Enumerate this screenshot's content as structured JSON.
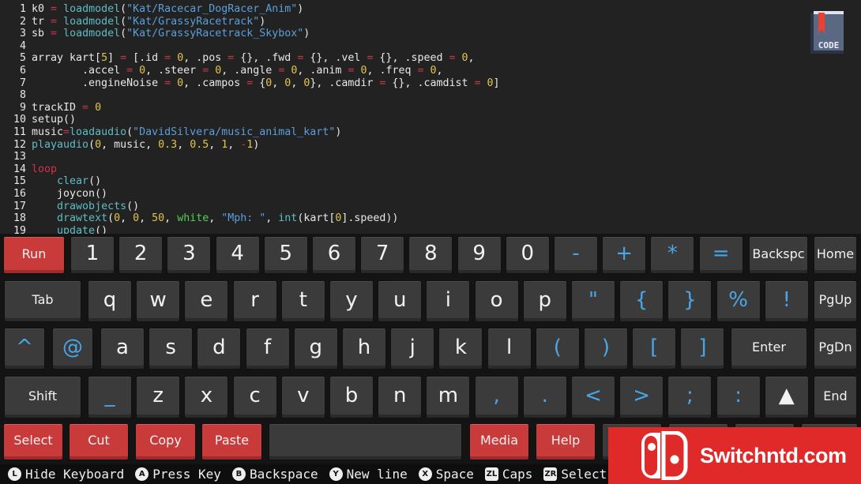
{
  "code": {
    "lines": [
      {
        "n": "1",
        "tokens": [
          [
            "plain",
            "k0 "
          ],
          [
            "op",
            "="
          ],
          [
            "plain",
            " "
          ],
          [
            "fn",
            "loadmodel"
          ],
          [
            "plain",
            "("
          ],
          [
            "str",
            "\"Kat/Racecar_DogRacer_Anim\""
          ],
          [
            "plain",
            ")"
          ]
        ]
      },
      {
        "n": "2",
        "tokens": [
          [
            "plain",
            "tr "
          ],
          [
            "op",
            "="
          ],
          [
            "plain",
            " "
          ],
          [
            "fn",
            "loadmodel"
          ],
          [
            "plain",
            "("
          ],
          [
            "str",
            "\"Kat/GrassyRacetrack\""
          ],
          [
            "plain",
            ")"
          ]
        ]
      },
      {
        "n": "3",
        "tokens": [
          [
            "plain",
            "sb "
          ],
          [
            "op",
            "="
          ],
          [
            "plain",
            " "
          ],
          [
            "fn",
            "loadmodel"
          ],
          [
            "plain",
            "("
          ],
          [
            "str",
            "\"Kat/GrassyRacetrack_Skybox\""
          ],
          [
            "plain",
            ")"
          ]
        ]
      },
      {
        "n": "4",
        "tokens": []
      },
      {
        "n": "5",
        "tokens": [
          [
            "plain",
            "array kart["
          ],
          [
            "num",
            "5"
          ],
          [
            "plain",
            "] "
          ],
          [
            "op",
            "="
          ],
          [
            "plain",
            " [.id "
          ],
          [
            "op",
            "="
          ],
          [
            "plain",
            " "
          ],
          [
            "num",
            "0"
          ],
          [
            "plain",
            ", .pos "
          ],
          [
            "op",
            "="
          ],
          [
            "plain",
            " {}, .fwd "
          ],
          [
            "op",
            "="
          ],
          [
            "plain",
            " {}, .vel "
          ],
          [
            "op",
            "="
          ],
          [
            "plain",
            " {}, .speed "
          ],
          [
            "op",
            "="
          ],
          [
            "plain",
            " "
          ],
          [
            "num",
            "0"
          ],
          [
            "plain",
            ","
          ]
        ]
      },
      {
        "n": "6",
        "tokens": [
          [
            "plain",
            "        .accel "
          ],
          [
            "op",
            "="
          ],
          [
            "plain",
            " "
          ],
          [
            "num",
            "0"
          ],
          [
            "plain",
            ", .steer "
          ],
          [
            "op",
            "="
          ],
          [
            "plain",
            " "
          ],
          [
            "num",
            "0"
          ],
          [
            "plain",
            ", .angle "
          ],
          [
            "op",
            "="
          ],
          [
            "plain",
            " "
          ],
          [
            "num",
            "0"
          ],
          [
            "plain",
            ", .anim "
          ],
          [
            "op",
            "="
          ],
          [
            "plain",
            " "
          ],
          [
            "num",
            "0"
          ],
          [
            "plain",
            ", .freq "
          ],
          [
            "op",
            "="
          ],
          [
            "plain",
            " "
          ],
          [
            "num",
            "0"
          ],
          [
            "plain",
            ","
          ]
        ]
      },
      {
        "n": "7",
        "tokens": [
          [
            "plain",
            "        .engineNoise "
          ],
          [
            "op",
            "="
          ],
          [
            "plain",
            " "
          ],
          [
            "num",
            "0"
          ],
          [
            "plain",
            ", .campos "
          ],
          [
            "op",
            "="
          ],
          [
            "plain",
            " {"
          ],
          [
            "num",
            "0"
          ],
          [
            "plain",
            ", "
          ],
          [
            "num",
            "0"
          ],
          [
            "plain",
            ", "
          ],
          [
            "num",
            "0"
          ],
          [
            "plain",
            "}, .camdir "
          ],
          [
            "op",
            "="
          ],
          [
            "plain",
            " {}, .camdist "
          ],
          [
            "op",
            "="
          ],
          [
            "plain",
            " "
          ],
          [
            "num",
            "0"
          ],
          [
            "plain",
            "]"
          ]
        ]
      },
      {
        "n": "8",
        "tokens": []
      },
      {
        "n": "9",
        "tokens": [
          [
            "plain",
            "trackID "
          ],
          [
            "op",
            "="
          ],
          [
            "plain",
            " "
          ],
          [
            "num",
            "0"
          ]
        ]
      },
      {
        "n": "10",
        "tokens": [
          [
            "plain",
            "setup()"
          ]
        ]
      },
      {
        "n": "11",
        "tokens": [
          [
            "plain",
            "music"
          ],
          [
            "op",
            "="
          ],
          [
            "fn",
            "loadaudio"
          ],
          [
            "plain",
            "("
          ],
          [
            "str",
            "\"DavidSilvera/music_animal_kart\""
          ],
          [
            "plain",
            ")"
          ]
        ]
      },
      {
        "n": "12",
        "tokens": [
          [
            "fn",
            "playaudio"
          ],
          [
            "plain",
            "("
          ],
          [
            "num",
            "0"
          ],
          [
            "plain",
            ", music, "
          ],
          [
            "num",
            "0.3"
          ],
          [
            "plain",
            ", "
          ],
          [
            "num",
            "0.5"
          ],
          [
            "plain",
            ", "
          ],
          [
            "num",
            "1"
          ],
          [
            "plain",
            ", "
          ],
          [
            "op",
            "-"
          ],
          [
            "num",
            "1"
          ],
          [
            "plain",
            ")"
          ]
        ]
      },
      {
        "n": "13",
        "tokens": []
      },
      {
        "n": "14",
        "tokens": [
          [
            "kw",
            "loop"
          ]
        ]
      },
      {
        "n": "15",
        "tokens": [
          [
            "plain",
            "    "
          ],
          [
            "fn",
            "clear"
          ],
          [
            "plain",
            "()"
          ]
        ]
      },
      {
        "n": "16",
        "tokens": [
          [
            "plain",
            "    joycon()"
          ]
        ]
      },
      {
        "n": "17",
        "tokens": [
          [
            "plain",
            "    "
          ],
          [
            "fn",
            "drawobjects"
          ],
          [
            "plain",
            "()"
          ]
        ]
      },
      {
        "n": "18",
        "tokens": [
          [
            "plain",
            "    "
          ],
          [
            "fn",
            "drawtext"
          ],
          [
            "plain",
            "("
          ],
          [
            "num",
            "0"
          ],
          [
            "plain",
            ", "
          ],
          [
            "num",
            "0"
          ],
          [
            "plain",
            ", "
          ],
          [
            "num",
            "50"
          ],
          [
            "plain",
            ", "
          ],
          [
            "grn",
            "white"
          ],
          [
            "plain",
            ", "
          ],
          [
            "str",
            "\"Mph: \""
          ],
          [
            "plain",
            ", "
          ],
          [
            "fn",
            "int"
          ],
          [
            "plain",
            "(kart["
          ],
          [
            "num",
            "0"
          ],
          [
            "plain",
            "].speed))"
          ]
        ]
      },
      {
        "n": "19",
        "tokens": [
          [
            "plain",
            "    "
          ],
          [
            "fn",
            "update"
          ],
          [
            "plain",
            "()"
          ]
        ]
      }
    ]
  },
  "code_icon": {
    "label": "CODE",
    "icon": "code-book-icon"
  },
  "keyboard": {
    "rows": [
      [
        {
          "l": "Run",
          "s": "red"
        },
        {
          "l": "1"
        },
        {
          "l": "2"
        },
        {
          "l": "3"
        },
        {
          "l": "4"
        },
        {
          "l": "5"
        },
        {
          "l": "6"
        },
        {
          "l": "7"
        },
        {
          "l": "8"
        },
        {
          "l": "9"
        },
        {
          "l": "0"
        },
        {
          "l": "-",
          "s": "blue"
        },
        {
          "l": "+",
          "s": "blue"
        },
        {
          "l": "*",
          "s": "blue"
        },
        {
          "l": "=",
          "s": "blue"
        },
        {
          "l": "Backspc",
          "s": "small"
        },
        {
          "l": "Home",
          "s": "small"
        }
      ],
      [
        {
          "l": "Tab",
          "s": "small"
        },
        {
          "l": "q"
        },
        {
          "l": "w"
        },
        {
          "l": "e"
        },
        {
          "l": "r"
        },
        {
          "l": "t"
        },
        {
          "l": "y"
        },
        {
          "l": "u"
        },
        {
          "l": "i"
        },
        {
          "l": "o"
        },
        {
          "l": "p"
        },
        {
          "l": "\"",
          "s": "blue"
        },
        {
          "l": "{",
          "s": "blue"
        },
        {
          "l": "}",
          "s": "blue"
        },
        {
          "l": "%",
          "s": "blue"
        },
        {
          "l": "!",
          "s": "blue"
        },
        {
          "l": "PgUp",
          "s": "small"
        }
      ],
      [
        {
          "l": "^",
          "s": "blue"
        },
        {
          "l": "@",
          "s": "blue"
        },
        {
          "l": "a"
        },
        {
          "l": "s"
        },
        {
          "l": "d"
        },
        {
          "l": "f"
        },
        {
          "l": "g"
        },
        {
          "l": "h"
        },
        {
          "l": "j"
        },
        {
          "l": "k"
        },
        {
          "l": "l"
        },
        {
          "l": "(",
          "s": "blue"
        },
        {
          "l": ")",
          "s": "blue"
        },
        {
          "l": "[",
          "s": "blue"
        },
        {
          "l": "]",
          "s": "blue"
        },
        {
          "l": "Enter",
          "s": "small"
        },
        {
          "l": "PgDn",
          "s": "small"
        }
      ],
      [
        {
          "l": "Shift",
          "s": "small"
        },
        {
          "l": "_",
          "s": "blue"
        },
        {
          "l": "z"
        },
        {
          "l": "x"
        },
        {
          "l": "c"
        },
        {
          "l": "v"
        },
        {
          "l": "b"
        },
        {
          "l": "n"
        },
        {
          "l": "m"
        },
        {
          "l": ",",
          "s": "blue"
        },
        {
          "l": ".",
          "s": "blue"
        },
        {
          "l": "<",
          "s": "blue"
        },
        {
          "l": ">",
          "s": "blue"
        },
        {
          "l": ";",
          "s": "blue"
        },
        {
          "l": ":",
          "s": "blue"
        },
        {
          "l": "▲"
        },
        {
          "l": "End",
          "s": "small"
        }
      ],
      [
        {
          "l": "Select",
          "s": "red"
        },
        {
          "l": "Cut",
          "s": "red"
        },
        {
          "l": "Copy",
          "s": "red"
        },
        {
          "l": "Paste",
          "s": "red"
        },
        {
          "l": "",
          "s": "space"
        },
        {
          "l": "Media",
          "s": "red"
        },
        {
          "l": "Help",
          "s": "red"
        },
        {
          "l": ""
        },
        {
          "l": ""
        },
        {
          "l": ""
        },
        {
          "l": ""
        }
      ]
    ]
  },
  "helpbar": [
    {
      "button": "L",
      "label": "Hide Keyboard",
      "icon": "l-stick-icon"
    },
    {
      "button": "A",
      "label": "Press Key",
      "icon": "a-button-icon"
    },
    {
      "button": "B",
      "label": "Backspace",
      "icon": "b-button-icon"
    },
    {
      "button": "Y",
      "label": "New line",
      "icon": "y-button-icon"
    },
    {
      "button": "X",
      "label": "Space",
      "icon": "x-button-icon"
    },
    {
      "button": "ZL",
      "label": "Caps",
      "icon": "zl-button-icon"
    },
    {
      "button": "ZR",
      "label": "Select",
      "icon": "zr-button-icon"
    }
  ],
  "watermark": {
    "text": "Switchntd.com",
    "color": "#e02a2a"
  },
  "colors": {
    "run_key": "#c93a3a",
    "symbol_text": "#4aa6e8",
    "key": "#3b3b3b"
  }
}
